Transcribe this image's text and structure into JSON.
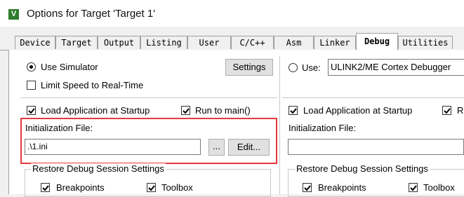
{
  "window": {
    "title": "Options for Target 'Target 1'"
  },
  "tabs": [
    {
      "label": "Device"
    },
    {
      "label": "Target"
    },
    {
      "label": "Output"
    },
    {
      "label": "Listing"
    },
    {
      "label": "User"
    },
    {
      "label": "C/C++"
    },
    {
      "label": "Asm"
    },
    {
      "label": "Linker"
    },
    {
      "label": "Debug"
    },
    {
      "label": "Utilities"
    }
  ],
  "left": {
    "use_simulator": "Use Simulator",
    "settings_btn": "Settings",
    "limit_speed": "Limit Speed to Real-Time",
    "load_app": "Load Application at Startup",
    "run_to_main": "Run to main()",
    "init_file_label": "Initialization File:",
    "init_file_value": ".\\1.ini",
    "browse_btn": "...",
    "edit_btn": "Edit...",
    "restore_title": "Restore Debug Session Settings",
    "breakpoints": "Breakpoints",
    "toolbox": "Toolbox"
  },
  "right": {
    "use_label": "Use:",
    "debugger_value": "ULINK2/ME Cortex Debugger",
    "load_app": "Load Application at Startup",
    "run_to_main_partial": "R",
    "init_file_label": "Initialization File:",
    "restore_title": "Restore Debug Session Settings",
    "breakpoints": "Breakpoints",
    "toolbox": "Toolbox"
  },
  "state": {
    "use_simulator": true,
    "limit_speed": false,
    "load_app": true,
    "run_to_main": true,
    "breakpoints": true,
    "toolbox": true,
    "right_load_app": true,
    "right_run_to_main": true,
    "right_breakpoints": true,
    "right_toolbox": true
  },
  "colors": {
    "highlight": "#e5393d",
    "panel": "#ffffff",
    "chrome": "#f0f0f0"
  }
}
